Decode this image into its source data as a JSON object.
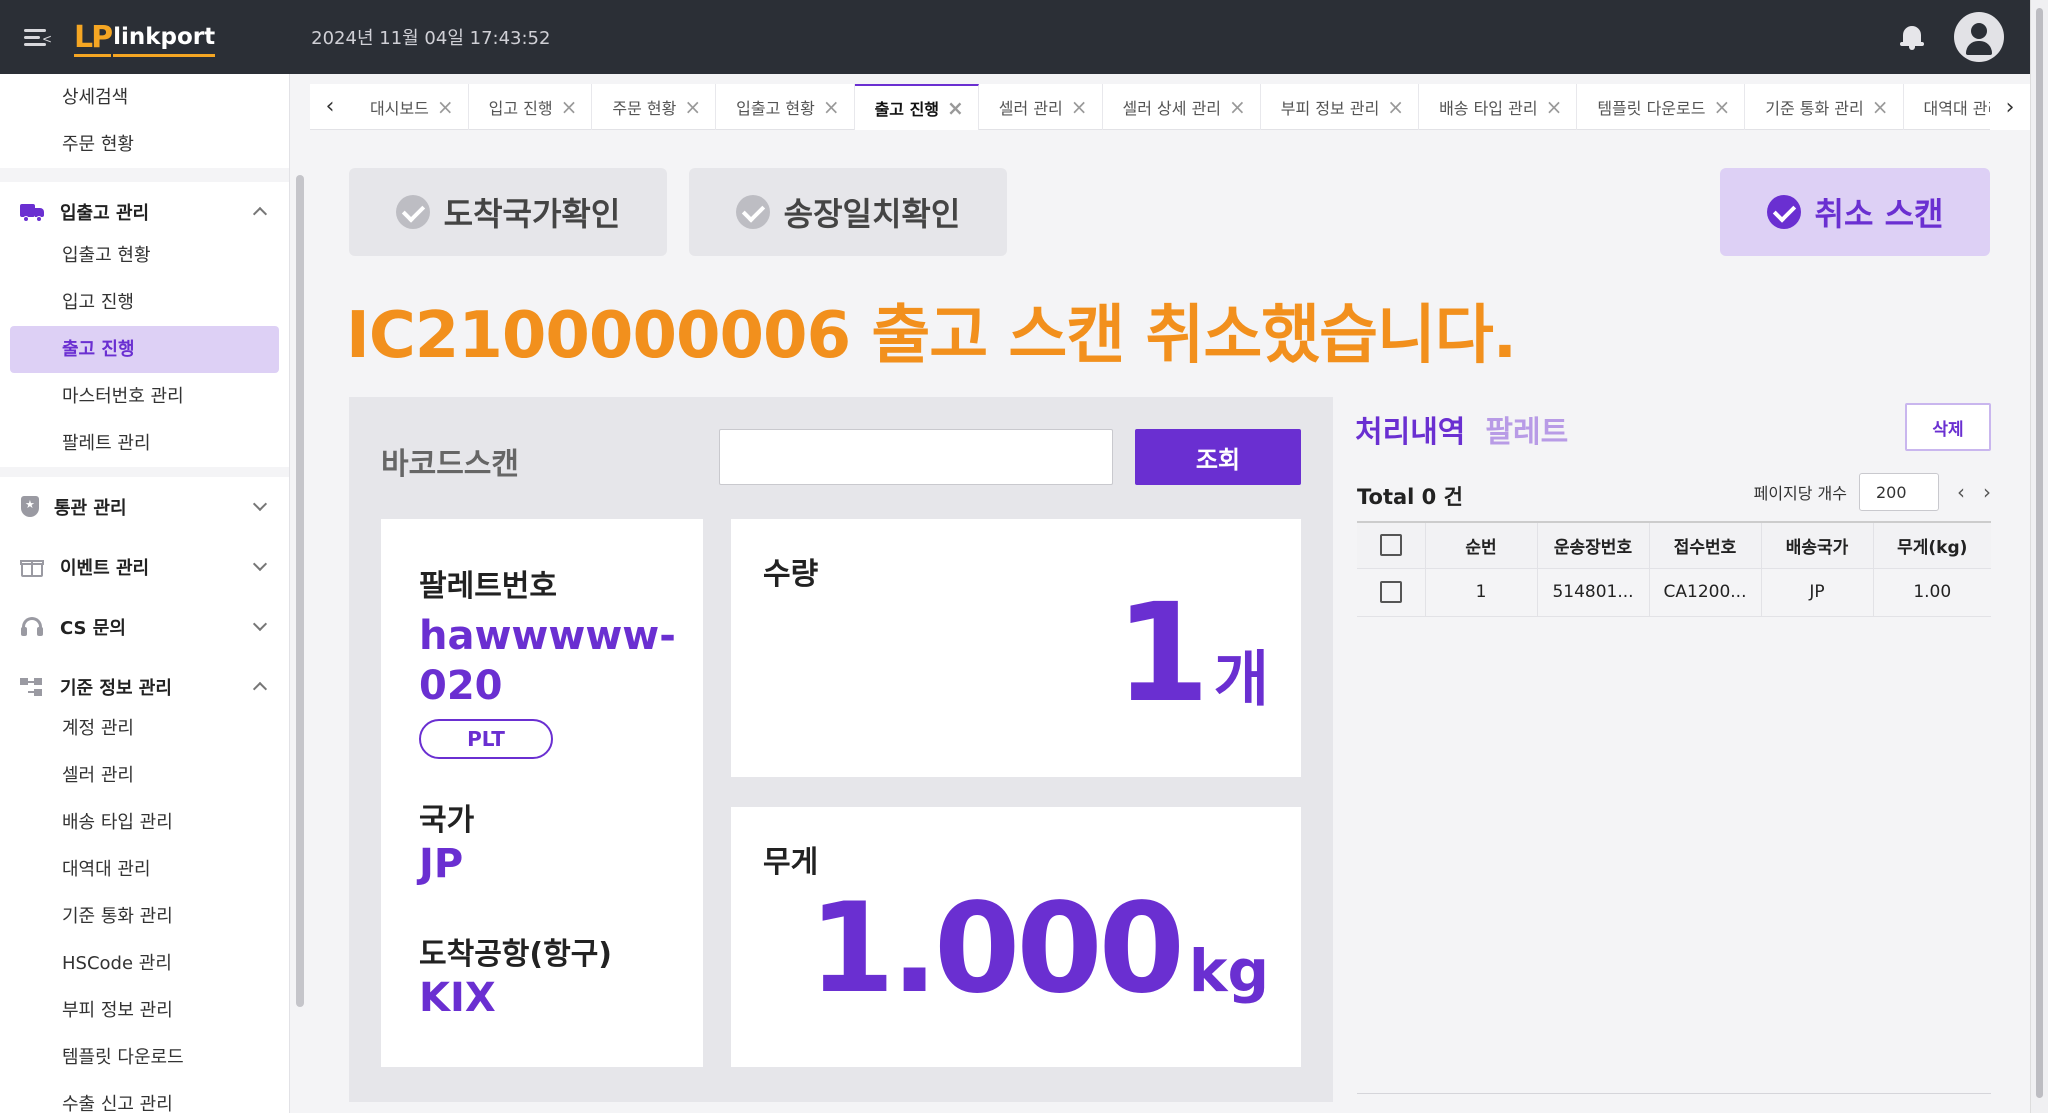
{
  "header": {
    "logo_mark": "LP",
    "logo_word": "linkport",
    "datetime": "2024년 11월 04일 17:43:52"
  },
  "sidebar": {
    "top_items": [
      "상세검색",
      "주문 현황"
    ],
    "groups": [
      {
        "label": "입출고 관리",
        "icon": "truck-icon",
        "expanded": true,
        "items": [
          "입출고 현황",
          "입고 진행",
          "출고 진행",
          "마스터번호 관리",
          "팔레트 관리"
        ],
        "active": "출고 진행"
      },
      {
        "label": "통관 관리",
        "icon": "shield-icon",
        "expanded": false,
        "items": []
      },
      {
        "label": "이벤트 관리",
        "icon": "gift-icon",
        "expanded": false,
        "items": []
      },
      {
        "label": "CS 문의",
        "icon": "headset-icon",
        "expanded": false,
        "items": []
      },
      {
        "label": "기준 정보 관리",
        "icon": "hierarchy-icon",
        "expanded": true,
        "items": [
          "계정 관리",
          "셀러 관리",
          "배송 타입 관리",
          "대역대 관리",
          "기준 통화 관리",
          "HSCode 관리",
          "부피 정보 관리",
          "템플릿 다운로드",
          "수출 신고 관리"
        ]
      }
    ]
  },
  "tabs": [
    {
      "label": "대시보드",
      "active": false
    },
    {
      "label": "입고 진행",
      "active": false
    },
    {
      "label": "주문 현황",
      "active": false
    },
    {
      "label": "입출고 현황",
      "active": false
    },
    {
      "label": "출고 진행",
      "active": true
    },
    {
      "label": "셀러 관리",
      "active": false
    },
    {
      "label": "셀러 상세 관리",
      "active": false
    },
    {
      "label": "부피 정보 관리",
      "active": false
    },
    {
      "label": "배송 타입 관리",
      "active": false
    },
    {
      "label": "템플릿 다운로드",
      "active": false
    },
    {
      "label": "기준 통화 관리",
      "active": false
    },
    {
      "label": "대역대 관리",
      "active": false
    }
  ],
  "modes": {
    "arrival_country": "도착국가확인",
    "invoice_match": "송장일치확인",
    "cancel_scan": "취소 스캔"
  },
  "message": "IC2100000006 출고 스캔 취소했습니다.",
  "scan": {
    "label": "바코드스캔",
    "input_value": "",
    "search_button": "조회"
  },
  "info": {
    "pallet_label": "팔레트번호",
    "pallet_value": "hawwwww-020",
    "pallet_badge": "PLT",
    "country_label": "국가",
    "country_value": "JP",
    "airport_label": "도착공항(항구)",
    "airport_value": "KIX"
  },
  "quantity": {
    "label": "수량",
    "value": "1",
    "unit": "개"
  },
  "weight": {
    "label": "무게",
    "value": "1.000",
    "unit": "kg"
  },
  "history": {
    "tab_active": "처리내역",
    "tab_inactive": "팔레트",
    "delete_button": "삭제",
    "total": "Total 0 건",
    "per_page_label": "페이지당 개수",
    "per_page_value": "200",
    "columns": [
      "순번",
      "운송장번호",
      "접수번호",
      "배송국가",
      "무게(kg)"
    ],
    "rows": [
      [
        "1",
        "514801...",
        "CA1200...",
        "JP",
        "1.00"
      ]
    ]
  },
  "colors": {
    "accent": "#6a2fd1",
    "message": "#f2901d",
    "header_bg": "#2b2f36"
  }
}
